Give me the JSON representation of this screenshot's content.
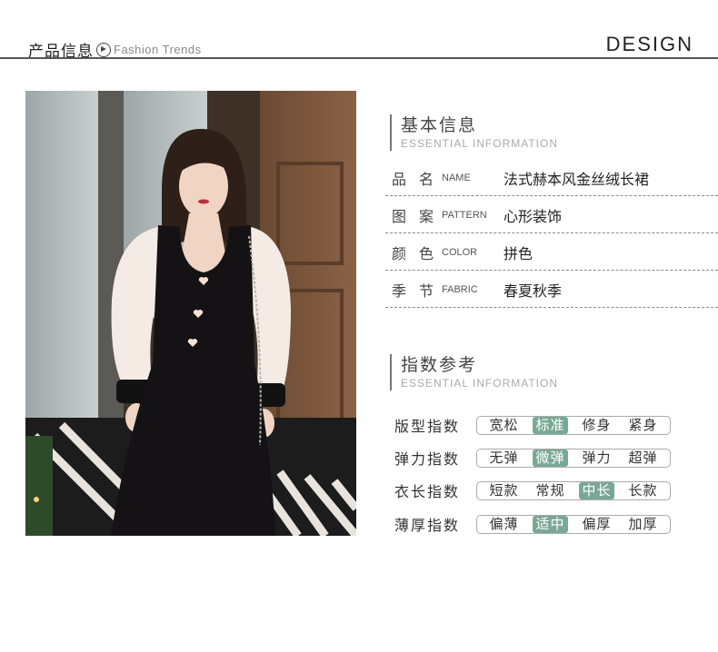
{
  "header": {
    "title": "产品信息",
    "subtitle": "Fashion Trends",
    "design": "DESIGN"
  },
  "basic": {
    "title": "基本信息",
    "subtitle": "ESSENTIAL INFORMATION",
    "rows": [
      {
        "key": "品名",
        "en": "NAME",
        "value": "法式赫本风金丝绒长裙"
      },
      {
        "key": "图案",
        "en": "PATTERN",
        "value": "心形装饰"
      },
      {
        "key": "颜色",
        "en": "COLOR",
        "value": "拼色"
      },
      {
        "key": "季节",
        "en": "FABRIC",
        "value": "春夏秋季"
      }
    ]
  },
  "index": {
    "title": "指数参考",
    "subtitle": "ESSENTIAL INFORMATION",
    "accent": "#7aa896",
    "rows": [
      {
        "label": "版型指数",
        "options": [
          "宽松",
          "标准",
          "修身",
          "紧身"
        ],
        "selected": "标准"
      },
      {
        "label": "弹力指数",
        "options": [
          "无弹",
          "微弹",
          "弹力",
          "超弹"
        ],
        "selected": "微弹"
      },
      {
        "label": "衣长指数",
        "options": [
          "短款",
          "常规",
          "中长",
          "长款"
        ],
        "selected": "中长"
      },
      {
        "label": "薄厚指数",
        "options": [
          "偏薄",
          "适中",
          "偏厚",
          "加厚"
        ],
        "selected": "适中"
      }
    ]
  }
}
